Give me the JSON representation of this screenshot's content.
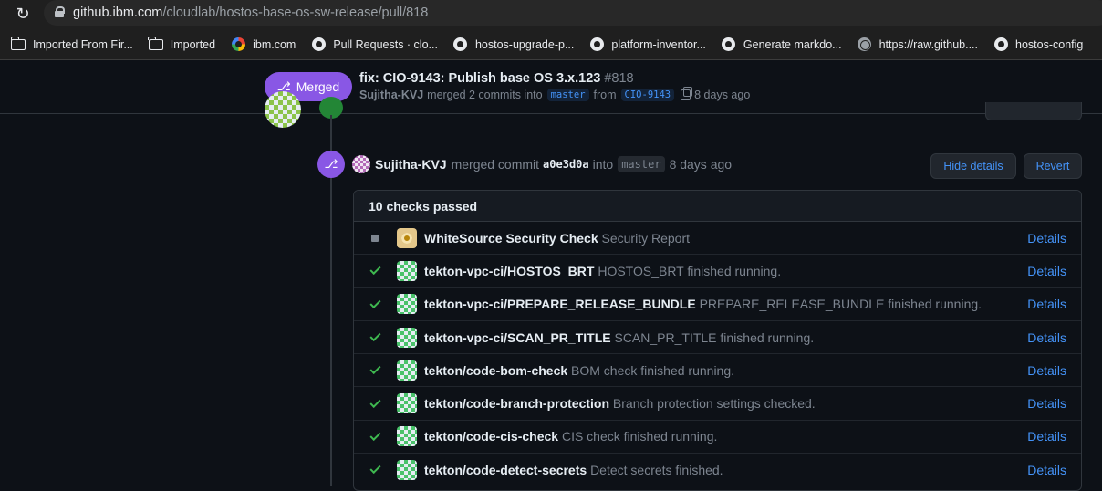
{
  "browser": {
    "url_host": "github.ibm.com",
    "url_path": "/cloudlab/hostos-base-os-sw-release/pull/818",
    "bookmarks": [
      {
        "label": "Imported From Fir...",
        "icon": "folder-icon"
      },
      {
        "label": "Imported",
        "icon": "folder-icon"
      },
      {
        "label": "ibm.com",
        "icon": "google-icon"
      },
      {
        "label": "Pull Requests · clo...",
        "icon": "github-icon"
      },
      {
        "label": "hostos-upgrade-p...",
        "icon": "github-icon"
      },
      {
        "label": "platform-inventor...",
        "icon": "github-icon"
      },
      {
        "label": "Generate markdo...",
        "icon": "github-icon"
      },
      {
        "label": "https://raw.github....",
        "icon": "globe-icon"
      },
      {
        "label": "hostos-config",
        "icon": "github-icon"
      }
    ]
  },
  "pr_header": {
    "state_label": "Merged",
    "title": "fix: CIO-9143: Publish base OS 3.x.123",
    "number": "#818",
    "author": "Sujitha-KVJ",
    "merged_text": "merged 2 commits into",
    "base_branch": "master",
    "from_text": "from",
    "head_branch": "CIO-9143",
    "time": "8 days ago"
  },
  "merge_event": {
    "author": "Sujitha-KVJ",
    "text": "merged commit",
    "sha": "a0e3d0a",
    "into_text": "into",
    "branch": "master",
    "time": "8 days ago",
    "hide_details_label": "Hide details",
    "revert_label": "Revert"
  },
  "checks": {
    "summary": "10 checks passed",
    "details_label": "Details",
    "items": [
      {
        "status": "pending",
        "app": "whitesource",
        "name": "WhiteSource Security Check",
        "desc": "Security Report"
      },
      {
        "status": "success",
        "app": "tekton",
        "name": "tekton-vpc-ci/HOSTOS_BRT",
        "desc": "HOSTOS_BRT finished running."
      },
      {
        "status": "success",
        "app": "tekton",
        "name": "tekton-vpc-ci/PREPARE_RELEASE_BUNDLE",
        "desc": "PREPARE_RELEASE_BUNDLE finished running."
      },
      {
        "status": "success",
        "app": "tekton",
        "name": "tekton-vpc-ci/SCAN_PR_TITLE",
        "desc": "SCAN_PR_TITLE finished running."
      },
      {
        "status": "success",
        "app": "tekton",
        "name": "tekton/code-bom-check",
        "desc": "BOM check finished running."
      },
      {
        "status": "success",
        "app": "tekton",
        "name": "tekton/code-branch-protection",
        "desc": "Branch protection settings checked."
      },
      {
        "status": "success",
        "app": "tekton",
        "name": "tekton/code-cis-check",
        "desc": "CIS check finished running."
      },
      {
        "status": "success",
        "app": "tekton",
        "name": "tekton/code-detect-secrets",
        "desc": "Detect secrets finished."
      }
    ]
  },
  "colors": {
    "merged_purple": "#8957e5",
    "success_green": "#3fb950",
    "link_blue": "#4493f8",
    "background": "#0d1117"
  }
}
